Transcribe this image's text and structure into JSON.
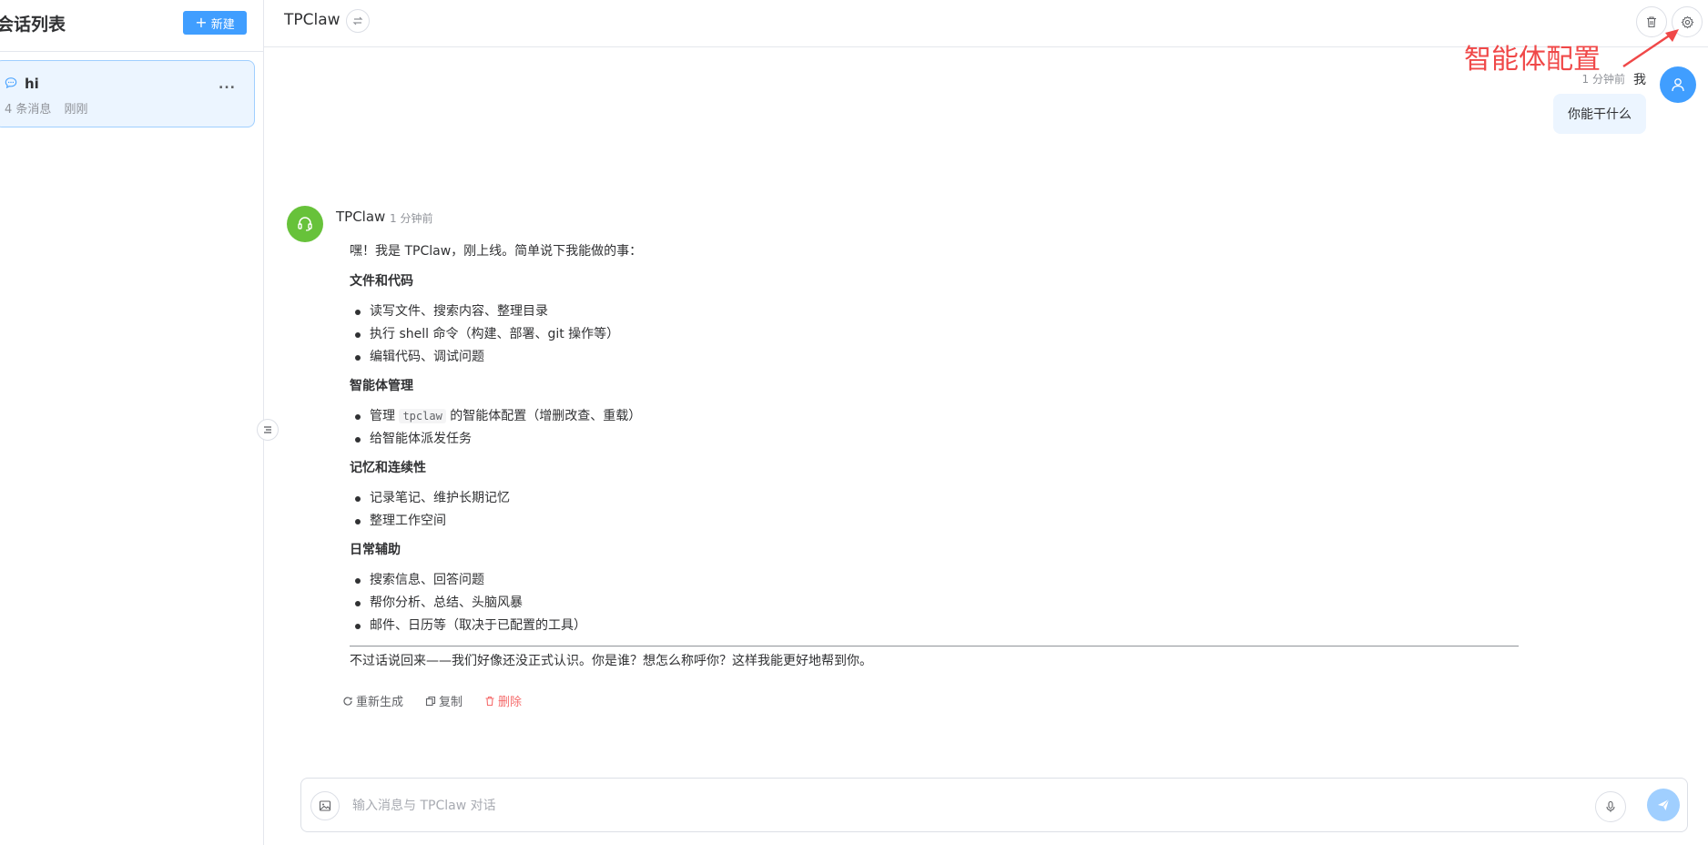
{
  "sidebar": {
    "title": "会话列表",
    "new_button": "新建",
    "sessions": [
      {
        "title": "hi",
        "message_count": "4 条消息",
        "time": "刚刚",
        "more": "..."
      }
    ]
  },
  "header": {
    "agent_name": "TPClaw",
    "switch_icon": "swap-icon",
    "delete_icon": "trash-icon",
    "settings_icon": "gear-icon"
  },
  "annotation": {
    "text": "智能体配置",
    "color": "#f04848"
  },
  "messages": {
    "user": {
      "name": "我",
      "time": "1 分钟前",
      "text": "你能干什么"
    },
    "assistant": {
      "name": "TPClaw",
      "time": "1 分钟前",
      "intro": "嘿！我是 TPClaw，刚上线。简单说下我能做的事：",
      "sections": [
        {
          "heading": "文件和代码",
          "items": [
            "读写文件、搜索内容、整理目录",
            "执行 shell 命令（构建、部署、git 操作等）",
            "编辑代码、调试问题"
          ]
        },
        {
          "heading": "智能体管理",
          "items_special": {
            "prefix": "管理",
            "code": "tpclaw",
            "suffix": "的智能体配置（增删改查、重载）"
          },
          "items": [
            "给智能体派发任务"
          ]
        },
        {
          "heading": "记忆和连续性",
          "items": [
            "记录笔记、维护长期记忆",
            "整理工作空间"
          ]
        },
        {
          "heading": "日常辅助",
          "items": [
            "搜索信息、回答问题",
            "帮你分析、总结、头脑风暴",
            "邮件、日历等（取决于已配置的工具）"
          ]
        }
      ],
      "closing": "不过话说回来——我们好像还没正式认识。你是谁？想怎么称呼你？这样我能更好地帮到你。",
      "actions": {
        "regenerate": "重新生成",
        "copy": "复制",
        "delete": "删除"
      }
    }
  },
  "input": {
    "placeholder": "输入消息与 TPClaw 对话"
  },
  "colors": {
    "primary": "#409eff",
    "assistant_avatar": "#67c23a",
    "danger": "#f56c6c"
  }
}
